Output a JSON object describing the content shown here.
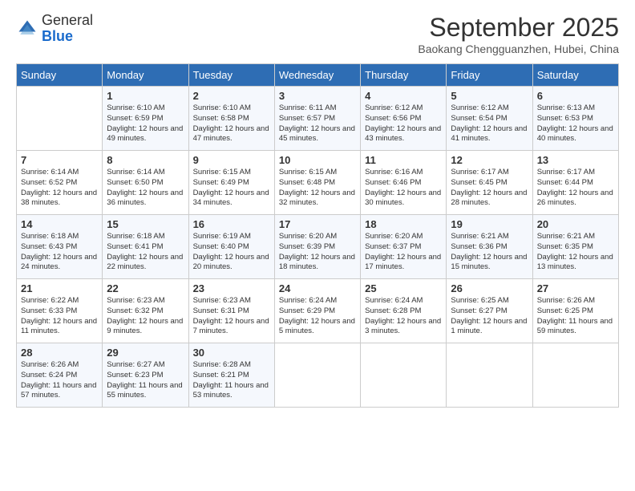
{
  "header": {
    "logo_line1": "General",
    "logo_line2": "Blue",
    "month_year": "September 2025",
    "location": "Baokang Chengguanzhen, Hubei, China"
  },
  "weekdays": [
    "Sunday",
    "Monday",
    "Tuesday",
    "Wednesday",
    "Thursday",
    "Friday",
    "Saturday"
  ],
  "weeks": [
    [
      {
        "day": "",
        "sunrise": "",
        "sunset": "",
        "daylight": ""
      },
      {
        "day": "1",
        "sunrise": "Sunrise: 6:10 AM",
        "sunset": "Sunset: 6:59 PM",
        "daylight": "Daylight: 12 hours and 49 minutes."
      },
      {
        "day": "2",
        "sunrise": "Sunrise: 6:10 AM",
        "sunset": "Sunset: 6:58 PM",
        "daylight": "Daylight: 12 hours and 47 minutes."
      },
      {
        "day": "3",
        "sunrise": "Sunrise: 6:11 AM",
        "sunset": "Sunset: 6:57 PM",
        "daylight": "Daylight: 12 hours and 45 minutes."
      },
      {
        "day": "4",
        "sunrise": "Sunrise: 6:12 AM",
        "sunset": "Sunset: 6:56 PM",
        "daylight": "Daylight: 12 hours and 43 minutes."
      },
      {
        "day": "5",
        "sunrise": "Sunrise: 6:12 AM",
        "sunset": "Sunset: 6:54 PM",
        "daylight": "Daylight: 12 hours and 41 minutes."
      },
      {
        "day": "6",
        "sunrise": "Sunrise: 6:13 AM",
        "sunset": "Sunset: 6:53 PM",
        "daylight": "Daylight: 12 hours and 40 minutes."
      }
    ],
    [
      {
        "day": "7",
        "sunrise": "Sunrise: 6:14 AM",
        "sunset": "Sunset: 6:52 PM",
        "daylight": "Daylight: 12 hours and 38 minutes."
      },
      {
        "day": "8",
        "sunrise": "Sunrise: 6:14 AM",
        "sunset": "Sunset: 6:50 PM",
        "daylight": "Daylight: 12 hours and 36 minutes."
      },
      {
        "day": "9",
        "sunrise": "Sunrise: 6:15 AM",
        "sunset": "Sunset: 6:49 PM",
        "daylight": "Daylight: 12 hours and 34 minutes."
      },
      {
        "day": "10",
        "sunrise": "Sunrise: 6:15 AM",
        "sunset": "Sunset: 6:48 PM",
        "daylight": "Daylight: 12 hours and 32 minutes."
      },
      {
        "day": "11",
        "sunrise": "Sunrise: 6:16 AM",
        "sunset": "Sunset: 6:46 PM",
        "daylight": "Daylight: 12 hours and 30 minutes."
      },
      {
        "day": "12",
        "sunrise": "Sunrise: 6:17 AM",
        "sunset": "Sunset: 6:45 PM",
        "daylight": "Daylight: 12 hours and 28 minutes."
      },
      {
        "day": "13",
        "sunrise": "Sunrise: 6:17 AM",
        "sunset": "Sunset: 6:44 PM",
        "daylight": "Daylight: 12 hours and 26 minutes."
      }
    ],
    [
      {
        "day": "14",
        "sunrise": "Sunrise: 6:18 AM",
        "sunset": "Sunset: 6:43 PM",
        "daylight": "Daylight: 12 hours and 24 minutes."
      },
      {
        "day": "15",
        "sunrise": "Sunrise: 6:18 AM",
        "sunset": "Sunset: 6:41 PM",
        "daylight": "Daylight: 12 hours and 22 minutes."
      },
      {
        "day": "16",
        "sunrise": "Sunrise: 6:19 AM",
        "sunset": "Sunset: 6:40 PM",
        "daylight": "Daylight: 12 hours and 20 minutes."
      },
      {
        "day": "17",
        "sunrise": "Sunrise: 6:20 AM",
        "sunset": "Sunset: 6:39 PM",
        "daylight": "Daylight: 12 hours and 18 minutes."
      },
      {
        "day": "18",
        "sunrise": "Sunrise: 6:20 AM",
        "sunset": "Sunset: 6:37 PM",
        "daylight": "Daylight: 12 hours and 17 minutes."
      },
      {
        "day": "19",
        "sunrise": "Sunrise: 6:21 AM",
        "sunset": "Sunset: 6:36 PM",
        "daylight": "Daylight: 12 hours and 15 minutes."
      },
      {
        "day": "20",
        "sunrise": "Sunrise: 6:21 AM",
        "sunset": "Sunset: 6:35 PM",
        "daylight": "Daylight: 12 hours and 13 minutes."
      }
    ],
    [
      {
        "day": "21",
        "sunrise": "Sunrise: 6:22 AM",
        "sunset": "Sunset: 6:33 PM",
        "daylight": "Daylight: 12 hours and 11 minutes."
      },
      {
        "day": "22",
        "sunrise": "Sunrise: 6:23 AM",
        "sunset": "Sunset: 6:32 PM",
        "daylight": "Daylight: 12 hours and 9 minutes."
      },
      {
        "day": "23",
        "sunrise": "Sunrise: 6:23 AM",
        "sunset": "Sunset: 6:31 PM",
        "daylight": "Daylight: 12 hours and 7 minutes."
      },
      {
        "day": "24",
        "sunrise": "Sunrise: 6:24 AM",
        "sunset": "Sunset: 6:29 PM",
        "daylight": "Daylight: 12 hours and 5 minutes."
      },
      {
        "day": "25",
        "sunrise": "Sunrise: 6:24 AM",
        "sunset": "Sunset: 6:28 PM",
        "daylight": "Daylight: 12 hours and 3 minutes."
      },
      {
        "day": "26",
        "sunrise": "Sunrise: 6:25 AM",
        "sunset": "Sunset: 6:27 PM",
        "daylight": "Daylight: 12 hours and 1 minute."
      },
      {
        "day": "27",
        "sunrise": "Sunrise: 6:26 AM",
        "sunset": "Sunset: 6:25 PM",
        "daylight": "Daylight: 11 hours and 59 minutes."
      }
    ],
    [
      {
        "day": "28",
        "sunrise": "Sunrise: 6:26 AM",
        "sunset": "Sunset: 6:24 PM",
        "daylight": "Daylight: 11 hours and 57 minutes."
      },
      {
        "day": "29",
        "sunrise": "Sunrise: 6:27 AM",
        "sunset": "Sunset: 6:23 PM",
        "daylight": "Daylight: 11 hours and 55 minutes."
      },
      {
        "day": "30",
        "sunrise": "Sunrise: 6:28 AM",
        "sunset": "Sunset: 6:21 PM",
        "daylight": "Daylight: 11 hours and 53 minutes."
      },
      {
        "day": "",
        "sunrise": "",
        "sunset": "",
        "daylight": ""
      },
      {
        "day": "",
        "sunrise": "",
        "sunset": "",
        "daylight": ""
      },
      {
        "day": "",
        "sunrise": "",
        "sunset": "",
        "daylight": ""
      },
      {
        "day": "",
        "sunrise": "",
        "sunset": "",
        "daylight": ""
      }
    ]
  ]
}
